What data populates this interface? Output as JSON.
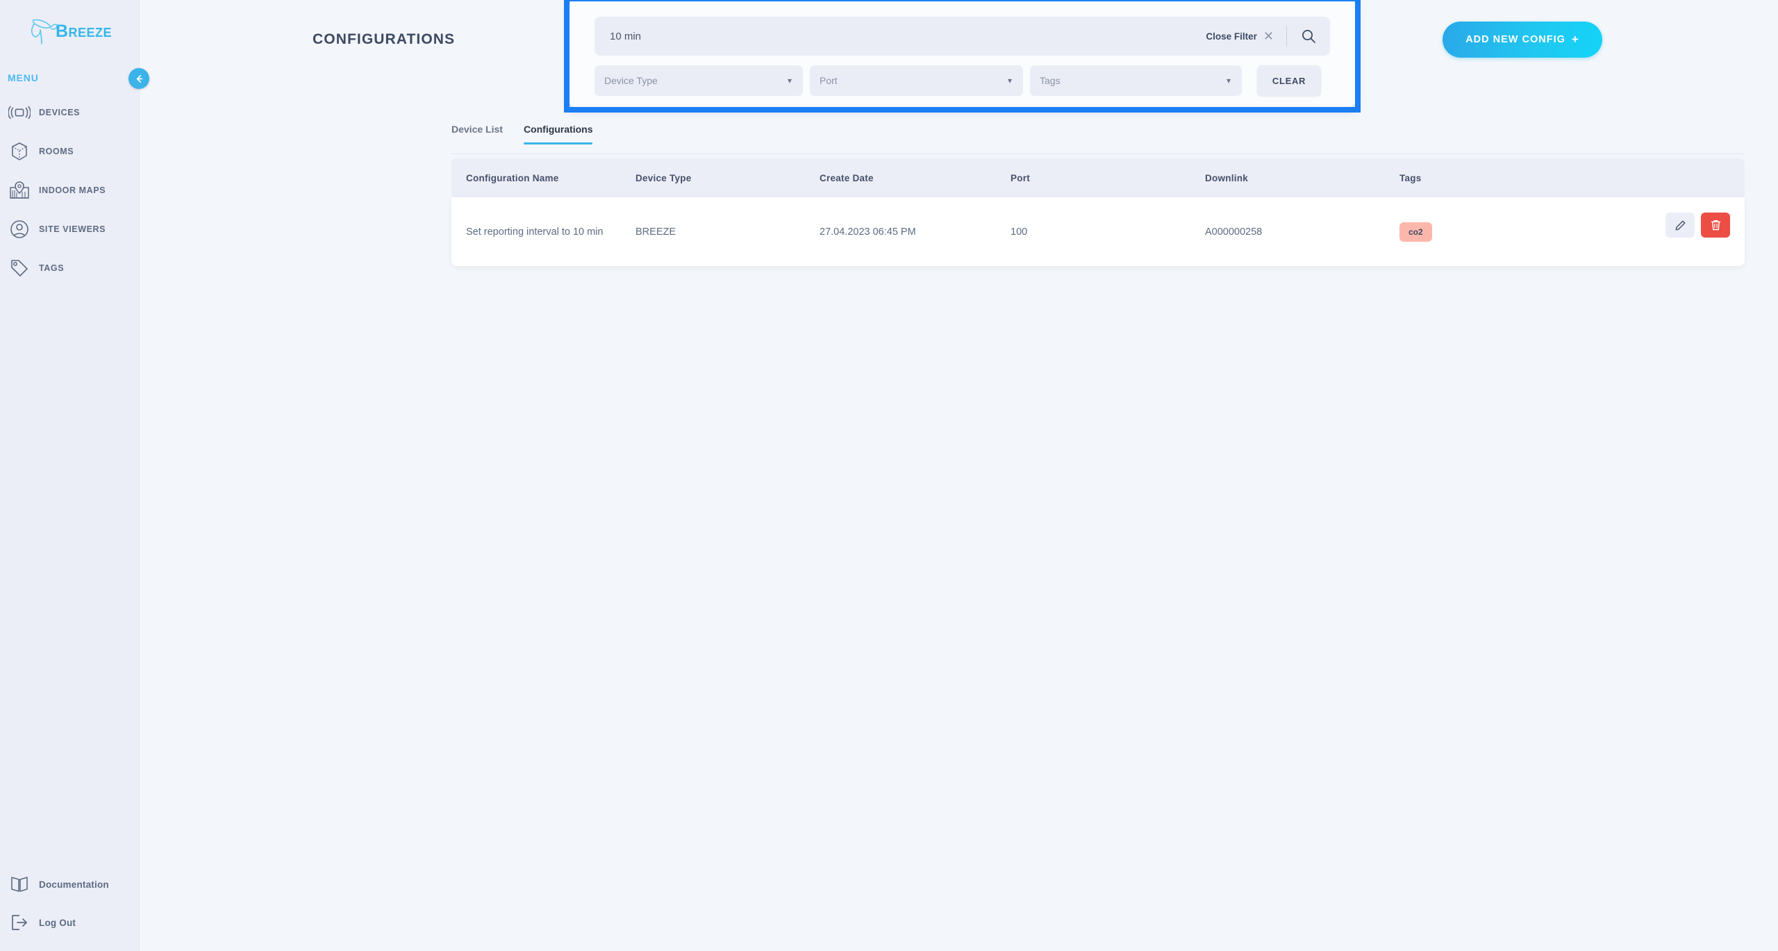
{
  "app": {
    "brand": "Breeze",
    "menu_label": "MENU",
    "collapse_icon": "arrow-left-icon"
  },
  "sidebar": {
    "items": [
      {
        "label": "DEVICES",
        "icon": "broadcast-device-icon"
      },
      {
        "label": "ROOMS",
        "icon": "cube-icon"
      },
      {
        "label": "INDOOR MAPS",
        "icon": "map-pin-icon"
      },
      {
        "label": "SITE VIEWERS",
        "icon": "user-circle-icon"
      },
      {
        "label": "TAGS",
        "icon": "tag-icon"
      }
    ],
    "footer_items": [
      {
        "label": "Documentation",
        "icon": "book-icon"
      },
      {
        "label": "Log Out",
        "icon": "logout-icon"
      }
    ]
  },
  "header": {
    "title": "CONFIGURATIONS",
    "add_button": "ADD NEW CONFIG",
    "add_button_plus": "+"
  },
  "filter": {
    "search_value": "10 min",
    "search_placeholder": "",
    "close_filter_label": "Close Filter",
    "close_icon": "close-x-icon",
    "search_icon": "search-icon",
    "device_type_select": "Device Type",
    "port_select": "Port",
    "tags_select": "Tags",
    "clear_label": "CLEAR",
    "caret_icon": "chevron-down-icon",
    "highlight_color": "#1a7ef5"
  },
  "tabs": [
    {
      "label": "Device List",
      "active": false
    },
    {
      "label": "Configurations",
      "active": true
    }
  ],
  "table": {
    "columns": [
      "Configuration Name",
      "Device Type",
      "Create Date",
      "Port",
      "Downlink",
      "Tags"
    ],
    "rows": [
      {
        "configuration_name": "Set reporting interval to 10 min",
        "device_type": "BREEZE",
        "create_date": "27.04.2023 06:45 PM",
        "port": "100",
        "downlink": "A000000258",
        "tags": [
          "co2"
        ]
      }
    ],
    "actions": {
      "edit_icon": "pencil-icon",
      "delete_icon": "trash-icon"
    }
  },
  "colors": {
    "accent": "#35b6ea",
    "highlight": "#1a7ef5",
    "danger": "#ec4d44",
    "tag_bg": "#fcb7ac",
    "sidebar_bg": "#eceef7",
    "page_bg": "#f3f6fa"
  }
}
